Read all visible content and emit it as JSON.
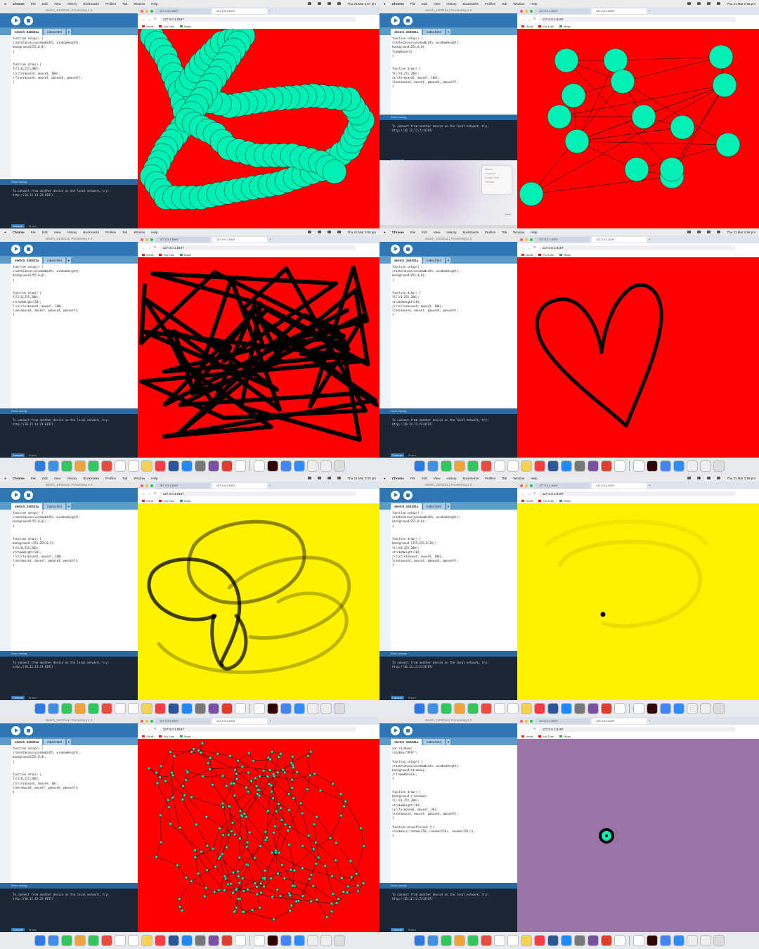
{
  "menubar": {
    "app": "Chrome",
    "items": [
      "File",
      "Edit",
      "View",
      "History",
      "Bookmarks",
      "Profiles",
      "Tab",
      "Window",
      "Help"
    ]
  },
  "processing": {
    "window_title": "sketch_240321a | Processing 4.2",
    "tabs": [
      "sketch_240321a",
      "index.html"
    ],
    "status": "Done saving.",
    "console_line1": "To connect from another device on the local network, try:",
    "console_line2": "http://10.12.13.23:8197/",
    "console_tab": "Console",
    "errors_tab": "Errors"
  },
  "chrome": {
    "tab_title": "127.0.0.1:8197",
    "url": "127.0.0.1:8197",
    "bookmarks": [
      "Gmail",
      "YouTube",
      "Maps"
    ]
  },
  "colors": {
    "red": "#fe0000",
    "aqua": "#00f0b4",
    "yellow": "#fff200",
    "purple": "#9a73a8",
    "processing_blue": "#2f77b4"
  },
  "panels": [
    {
      "clock": "Thu 21 Mar 2:57 pm",
      "canvas": "worm",
      "code": [
        "function setup() {",
        "createCanvas(windowWidth, windowHeight);",
        "background(255,0,0);",
        "}",
        "",
        "",
        "function draw() {",
        "fill(0,255,200);",
        "circle(mouseX, mouseY, 100);",
        "//line(mouseX, mouseY, pmouseX, pmouseY);",
        "}"
      ]
    },
    {
      "clock": "Thu 21 Mar 2:55 pm",
      "canvas": "network",
      "code": [
        "function setup() {",
        "createCanvas(windowWidth, windowHeight);",
        "background(255,0,0);",
        "frameRate(5)",
        "}",
        "",
        "",
        "function draw() {",
        "fill(0,255,200);",
        "circle(mouseX, mouseY, 100);",
        "line(mouseX, mouseY, pmouseX, pmouseY);",
        "}"
      ],
      "popup": [
        "Shared",
        "Locations",
        "Google Drive",
        "Network"
      ],
      "popup_user": "lucky"
    },
    {
      "clock": "Thu 21 Mar 2:59 pm",
      "canvas": "scribble",
      "code": [
        "function setup() {",
        "createCanvas(windowWidth, windowHeight);",
        "background(255,0,0);",
        "}",
        "",
        "",
        "function draw() {",
        "fill(0,255,200);",
        "strokeWeight(20);",
        "//circle(mouseX, mouseY, 100);",
        "line(mouseX, mouseY, pmouseX, pmouseY);",
        "}"
      ]
    },
    {
      "clock": "Thu 21 Mar 2:59 pm",
      "canvas": "heart",
      "code": [
        "function setup() {",
        "createCanvas(windowWidth, windowHeight);",
        "background(255,0,0);",
        "}",
        "",
        "",
        "function draw() {",
        "fill(0,255,200);",
        "strokeWeight(20);",
        "//circle(mouseX, mouseY, 100);",
        "line(mouseX, mouseY, pmouseX, pmouseY);",
        "}"
      ]
    },
    {
      "clock": "Thu 21 Mar 3:00 pm",
      "canvas": "yellowloops",
      "code": [
        "function setup() {",
        "createCanvas(windowWidth, windowHeight);",
        "background(255,0,0);",
        "}",
        "",
        "",
        "function draw() {",
        "background (255,255,0,5);",
        "fill(0,255,200);",
        "strokeWeight(20);",
        "//circle(mouseX, mouseY, 100);",
        "line(mouseX, mouseY, pmouseX, pmouseY);",
        "}"
      ]
    },
    {
      "clock": "Thu 21 Mar 2:59 pm",
      "canvas": "yellowfaint",
      "code": [
        "function setup() {",
        "createCanvas(windowWidth, windowHeight);",
        "background(255,0,0);",
        "}",
        "",
        "",
        "function draw() {",
        "background (255,255,0,20);",
        "fill(0,255,200);",
        "strokeWeight(20);",
        "//circle(mouseX, mouseY, 100);",
        "line(mouseX, mouseY, pmouseX, pmouseY);",
        "}"
      ]
    },
    {
      "clock": "",
      "canvas": "dots",
      "code": [
        "function setup() {",
        "createCanvas(windowWidth, windowHeight);",
        "background(255,0,0);",
        "}",
        "",
        "",
        "function draw() {",
        "fill(0,255,200);",
        "circle(mouseX, mouseY, 10);",
        "line(mouseX, mouseY, pmouseX, pmouseY);",
        "}"
      ]
    },
    {
      "clock": "",
      "canvas": "purple",
      "code": [
        "var rainbow;",
        "rainbow=\"#FFF\";",
        "",
        "function setup() {",
        "createCanvas(windowWidth, windowHeight);",
        "background(rainbow);",
        "//frameRate(4);",
        "}",
        "",
        "",
        "function draw() {",
        "background (rainbow);",
        "fill(0,255,200);",
        "strokeWeight(10);",
        "circle(mouseX, mouseY, 30);",
        "line(mouseX, mouseY, pmouseX, pmouseY);",
        "}",
        "",
        "function mousePressed (){",
        "rainbow=([random(256),random(256), random(256)]);",
        "}"
      ]
    }
  ]
}
